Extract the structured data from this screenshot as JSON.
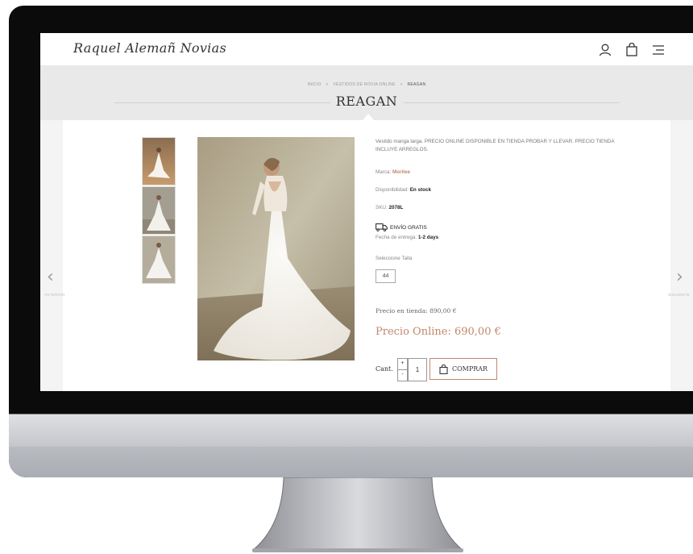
{
  "header": {
    "logo": "Raquel Alemañ Novias",
    "icons": [
      "user-icon",
      "bag-icon",
      "menu-icon"
    ]
  },
  "breadcrumb": {
    "items": [
      "INICIO",
      "VESTIDOS DE NOVIA ONLINE",
      "REAGAN"
    ],
    "separator": ">"
  },
  "page_title": "REAGAN",
  "nav": {
    "prev_label": "ANTERIOR",
    "next_label": "SIGUIENTE"
  },
  "product": {
    "description": "Vestido manga larga. PRECIO ONLINE DISPONIBLE EN TIENDA PROBAR Y LLEVAR. PRECIO TIENDA INCLUYE ARREGLOS.",
    "brand_label": "Marca:",
    "brand_value": "Morilee",
    "availability_label": "Disponibilidad:",
    "availability_value": "En stock",
    "sku_label": "SKU:",
    "sku_value": "2078L",
    "shipping_label": "ENVÍO GRATIS",
    "delivery_label": "Fecha de entrega:",
    "delivery_value": "1-2 days",
    "size_label": "Seleccione Talla",
    "size_option": "44",
    "store_price": "Precio en tienda: 890,00 €",
    "online_price": "Precio Online: 690,00 €",
    "qty_label": "Cant.",
    "qty_value": "1",
    "qty_plus": "+",
    "qty_minus": "-",
    "buy_label": "COMPRAR"
  },
  "colors": {
    "accent": "#c0876d",
    "title_bar": "#e9e9e9",
    "bezel": "#0b0b0c"
  }
}
